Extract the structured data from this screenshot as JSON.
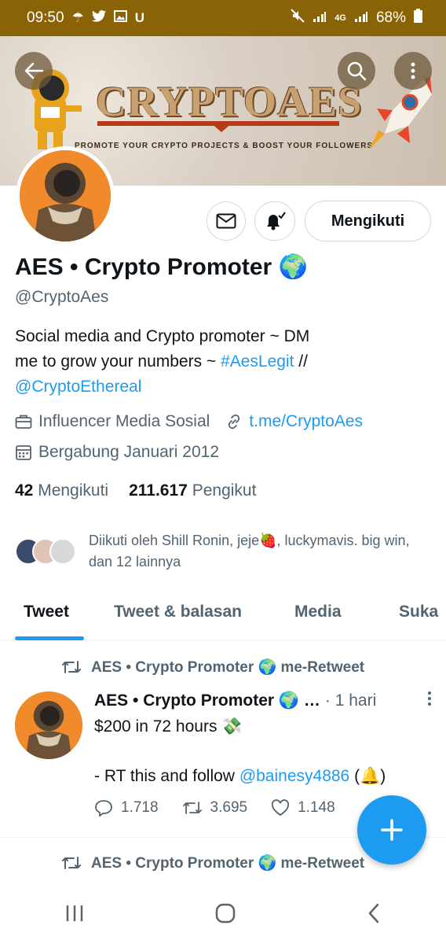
{
  "status_bar": {
    "time": "09:50",
    "left_icons": [
      "weather-icon",
      "twitter-icon",
      "gallery-icon",
      "u-icon"
    ],
    "signal_label": "4G",
    "battery": "68%"
  },
  "banner": {
    "title": "CRYPTOAES",
    "tagline": "PROMOTE YOUR CRYPTO PROJECTS & BOOST YOUR FOLLOWERS"
  },
  "profile": {
    "name": "AES • Crypto Promoter 🌍",
    "handle": "@CryptoAes",
    "bio_line1": "Social media and Crypto promoter ~ DM",
    "bio_line2_prefix": "me to grow your numbers ~ ",
    "bio_hashtag": "#AesLegit",
    "bio_line2_suffix": " //",
    "bio_mention": "@CryptoEthereal",
    "category": "Influencer Media Sosial",
    "website": "t.me/CryptoAes",
    "joined": "Bergabung Januari 2012",
    "following_count": "42",
    "following_label": "Mengikuti",
    "followers_count": "211.617",
    "followers_label": "Pengikut",
    "followed_by": "Diikuti oleh Shill Ronin, jeje🍓, luckymavis. big win, dan 12 lainnya",
    "follow_button": "Mengikuti"
  },
  "tabs": [
    {
      "label": "Tweet",
      "active": true
    },
    {
      "label": "Tweet & balasan",
      "active": false
    },
    {
      "label": "Media",
      "active": false
    },
    {
      "label": "Suka",
      "active": false
    }
  ],
  "tweet": {
    "retweet_label": "AES • Crypto Promoter 🌍 me-Retweet",
    "author": "AES • Crypto Promoter 🌍 …",
    "time": "· 1 hari",
    "line1": "$200 in 72 hours 💸",
    "line2_prefix": "- RT this and follow ",
    "line2_mention": "@bainesy4886",
    "line2_suffix": " (🔔)",
    "replies": "1.718",
    "retweets": "3.695",
    "likes": "1.148"
  },
  "next_tweet": {
    "retweet_label": "AES • Crypto Promoter 🌍 me-Retweet"
  },
  "colors": {
    "accent": "#1d9bf0",
    "status_bar": "#8a6306",
    "secondary_text": "#536471"
  }
}
